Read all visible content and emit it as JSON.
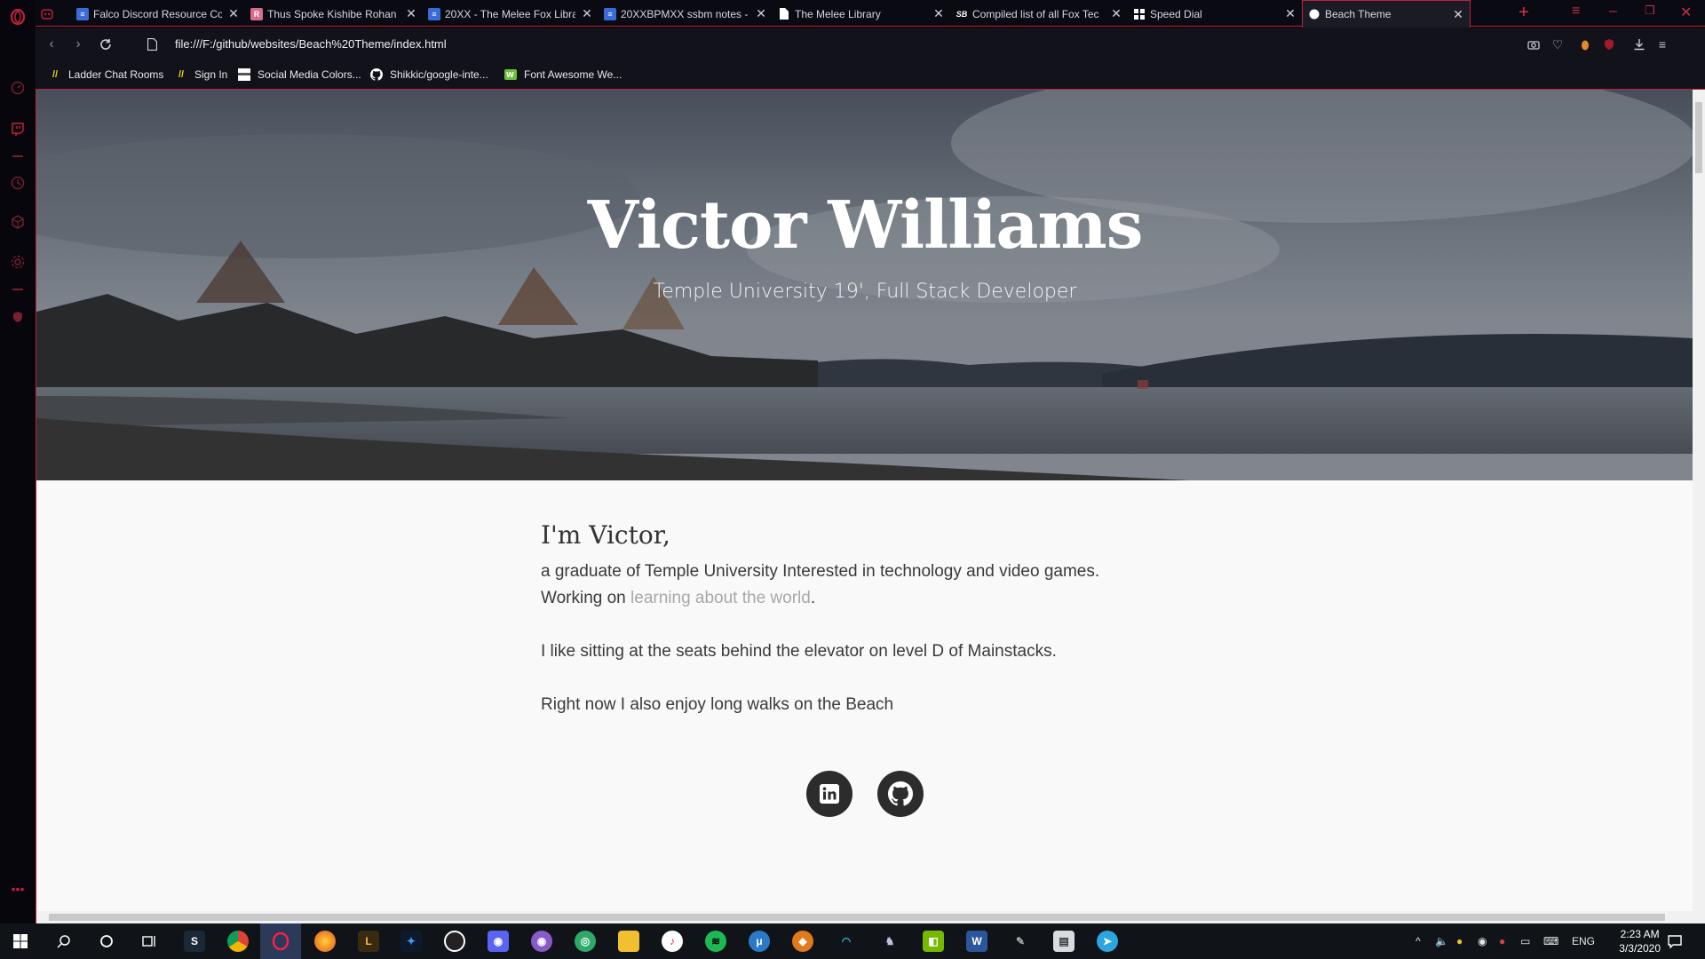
{
  "browser": {
    "tabs": [
      {
        "title": "Falco Discord Resource Co",
        "favicon_color": "#3a6bd8",
        "favicon": "doc-icon",
        "active": false
      },
      {
        "title": "Thus Spoke Kishibe Rohan",
        "favicon_color": "#d86a8a",
        "favicon": "book-icon",
        "active": false
      },
      {
        "title": "20XX - The Melee Fox Libra",
        "favicon_color": "#3a6bd8",
        "favicon": "doc-icon",
        "active": false
      },
      {
        "title": "20XXBPMXX ssbm notes - G",
        "favicon_color": "#3a6bd8",
        "favicon": "doc-icon",
        "active": false
      },
      {
        "title": "The Melee Library",
        "favicon_color": "#ffffff",
        "favicon": "page-icon",
        "active": false
      },
      {
        "title": "Compiled list of all Fox Tec",
        "favicon_color": "#ffffff",
        "favicon": "sb-icon",
        "active": false
      },
      {
        "title": "Speed Dial",
        "favicon_color": "#ffffff",
        "favicon": "grid-icon",
        "active": false
      },
      {
        "title": "Beach Theme",
        "favicon_color": "#ffffff",
        "favicon": "globe-icon",
        "active": true
      }
    ],
    "url": "file:///F:/github/websites/Beach%20Theme/index.html",
    "bookmarks": [
      {
        "label": "Ladder Chat Rooms",
        "icon": "ladder-icon"
      },
      {
        "label": "Sign In",
        "icon": "ladder-icon"
      },
      {
        "label": "Social Media Colors...",
        "icon": "page-icon"
      },
      {
        "label": "Shikkic/google-inte...",
        "icon": "github-icon"
      },
      {
        "label": "Font Awesome We...",
        "icon": "fontawesome-icon"
      }
    ]
  },
  "page": {
    "hero_title": "Victor Williams",
    "hero_subtitle": "Temple University 19', Full Stack Developer",
    "greeting": "I'm Victor,",
    "intro_line1": "a graduate of Temple University Interested in technology and video games.",
    "working_prefix": "Working on ",
    "working_link": "learning about the world",
    "working_suffix": ".",
    "para2": "I like sitting at the seats behind the elevator on level D of Mainstacks.",
    "para3": "Right now I also enjoy long walks on the Beach",
    "socials": [
      {
        "name": "linkedin-icon"
      },
      {
        "name": "github-icon"
      }
    ]
  },
  "taskbar": {
    "language": "ENG",
    "time": "2:23 AM",
    "date": "3/3/2020"
  }
}
